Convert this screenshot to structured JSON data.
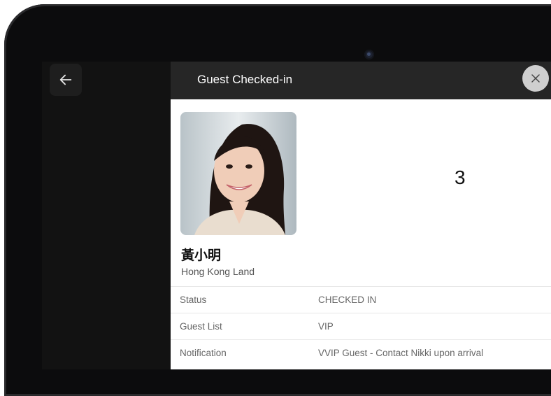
{
  "header": {
    "title": "Guest Checked-in"
  },
  "counter": "3",
  "guest": {
    "name": "黃小明",
    "company": "Hong Kong Land"
  },
  "details": [
    {
      "label": "Status",
      "value": "CHECKED IN"
    },
    {
      "label": "Guest List",
      "value": "VIP"
    },
    {
      "label": "Notification",
      "value": "VVIP Guest - Contact Nikki upon arrival"
    }
  ],
  "icons": {
    "back": "arrow-left-icon",
    "close": "close-icon"
  },
  "colors": {
    "header_bg": "#262626",
    "close_bg": "#cfcfcf"
  }
}
